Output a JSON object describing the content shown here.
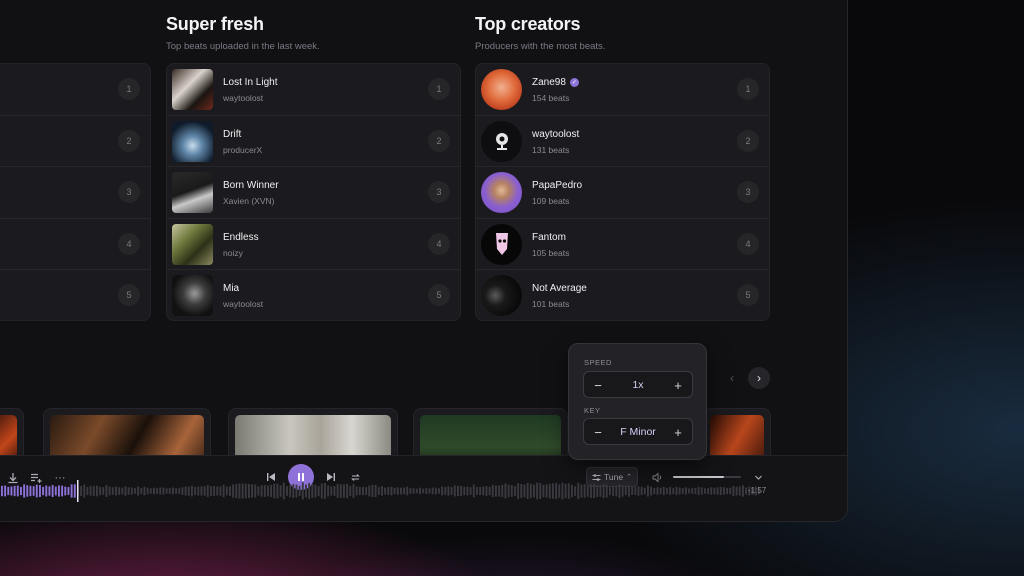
{
  "super_fresh": {
    "title": "Super fresh",
    "subtitle": "Top beats uploaded in the last week.",
    "items": [
      {
        "title": "Lost In Light",
        "artist": "waytoolost",
        "rank": "1"
      },
      {
        "title": "Drift",
        "artist": "producerX",
        "rank": "2"
      },
      {
        "title": "Born Winner",
        "artist": "Xavien (XVN)",
        "rank": "3"
      },
      {
        "title": "Endless",
        "artist": "noizy",
        "rank": "4"
      },
      {
        "title": "Mia",
        "artist": "waytoolost",
        "rank": "5"
      }
    ]
  },
  "top_creators": {
    "title": "Top creators",
    "subtitle": "Producers with the most beats.",
    "items": [
      {
        "name": "Zane98",
        "beats": "154 beats",
        "rank": "1",
        "verified": true
      },
      {
        "name": "waytoolost",
        "beats": "131 beats",
        "rank": "2"
      },
      {
        "name": "PapaPedro",
        "beats": "109 beats",
        "rank": "3"
      },
      {
        "name": "Fantom",
        "beats": "105 beats",
        "rank": "4"
      },
      {
        "name": "Not Average",
        "beats": "101 beats",
        "rank": "5"
      }
    ]
  },
  "left_list": {
    "ranks": [
      "1",
      "2",
      "3",
      "4",
      "5"
    ]
  },
  "tune_popup": {
    "speed_label": "SPEED",
    "speed_value": "1x",
    "key_label": "KEY",
    "key_value": "F Minor"
  },
  "player": {
    "tune_label": "Tune",
    "time_remaining": "-1:57",
    "progress_fraction": 0.1,
    "volume_fraction": 0.75,
    "state": "playing"
  },
  "colors": {
    "accent": "#8f72d9",
    "background": "#111114",
    "card": "#1b1b1f",
    "text_muted": "#8a8a93"
  },
  "icons": {
    "download": "download-icon",
    "add_to_queue": "add-to-queue-icon",
    "more": "more-icon",
    "previous": "skip-previous-icon",
    "pause": "pause-icon",
    "next": "skip-next-icon",
    "repeat": "repeat-icon",
    "tune": "tune-icon",
    "volume": "volume-icon",
    "collapse": "chevron-down-icon"
  }
}
